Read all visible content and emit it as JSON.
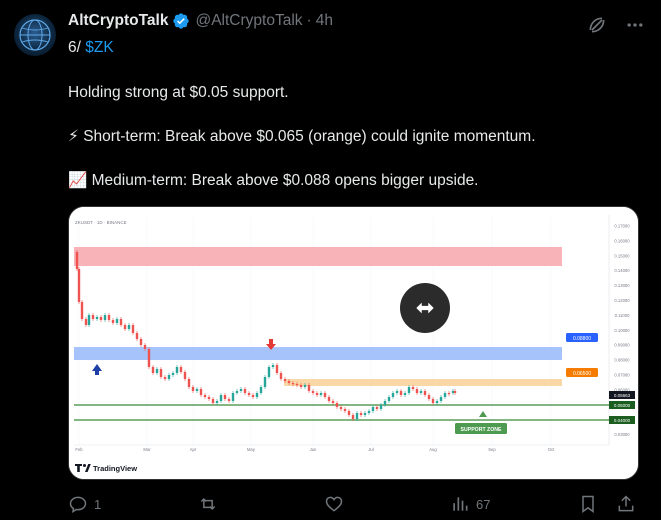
{
  "author": {
    "display_name": "AltCryptoTalk",
    "handle": "@AltCryptoTalk",
    "time": "4h",
    "separator": "·",
    "verified_icon": "verified-badge-icon",
    "avatar_icon": "globe-avatar"
  },
  "thread": {
    "index": "6/",
    "cashtag": "$ZK"
  },
  "body": {
    "line1": "Holding strong at $0.05 support.",
    "line2_emoji": "⚡",
    "line2": "Short-term: Break above $0.065 (orange) could ignite momentum.",
    "line3_emoji": "📈",
    "line3": "Medium-term: Break above $0.088 opens bigger upside."
  },
  "chart": {
    "source": "ZKUSDT · 1D · BINANCE",
    "brand": "TradingView",
    "support_label": "SUPPORT ZONE",
    "price_labels": {
      "upper": "0.08800",
      "middle": "0.06500",
      "current": "0.05663",
      "lower_a": "0.05000",
      "lower_b": "0.04000"
    },
    "price_ticks": [
      "0.17000",
      "0.16000",
      "0.15000",
      "0.14000",
      "0.13000",
      "0.12000",
      "0.11000",
      "0.10000",
      "0.09000",
      "0.08000",
      "0.07000",
      "0.06000",
      "0.05000",
      "0.04000",
      "0.03000"
    ],
    "time_ticks": [
      "Feb",
      "Mar",
      "Apr",
      "May",
      "Jun",
      "Jul",
      "Aug",
      "Sep",
      "Oct"
    ],
    "colors": {
      "red_zone": "#f7b3b8",
      "blue_zone": "#a6c4fb",
      "orange_zone": "#f9d7a6",
      "support_line": "#3a8a3a",
      "up": "#26a69a",
      "down": "#ef5350"
    }
  },
  "actions": {
    "reply_count": "1",
    "retweet_count": "",
    "like_count": "",
    "views_count": "67"
  }
}
